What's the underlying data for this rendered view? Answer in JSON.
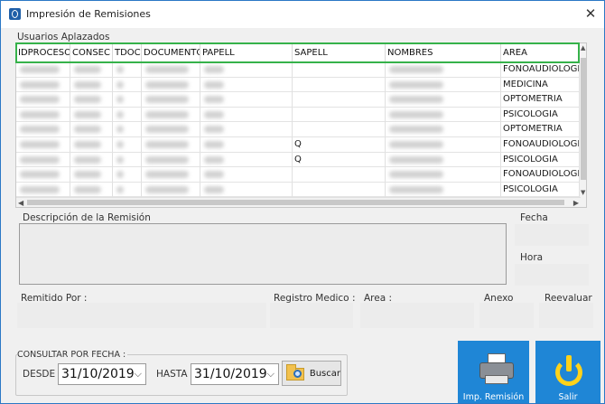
{
  "window": {
    "title": "Impresión de Remisiones",
    "close_glyph": "✕"
  },
  "grid": {
    "group_label": "Usuarios Aplazados",
    "columns": [
      "IDPROCESO",
      "CONSEC",
      "TDOC",
      "DOCUMENTO",
      "PAPELL",
      "SAPELL",
      "NOMBRES",
      "AREA"
    ],
    "rows": [
      {
        "sapell": "",
        "area": "FONOAUDIOLOGIA"
      },
      {
        "sapell": "",
        "area": "MEDICINA"
      },
      {
        "sapell": "",
        "area": "OPTOMETRIA"
      },
      {
        "sapell": "",
        "area": "PSICOLOGIA"
      },
      {
        "sapell": "",
        "area": "OPTOMETRIA"
      },
      {
        "sapell": "Q",
        "area": "FONOAUDIOLOGIA"
      },
      {
        "sapell": "Q",
        "area": "PSICOLOGIA"
      },
      {
        "sapell": "",
        "area": "FONOAUDIOLOGIA"
      },
      {
        "sapell": "",
        "area": "PSICOLOGIA"
      }
    ]
  },
  "descripcion": {
    "label": "Descripción de la Remisión"
  },
  "fecha": {
    "label": "Fecha"
  },
  "hora": {
    "label": "Hora"
  },
  "remitido": {
    "label": "Remitido Por :"
  },
  "registro": {
    "label": "Registro Medico :"
  },
  "area": {
    "label": "Area :"
  },
  "anexo": {
    "label": "Anexo"
  },
  "reevaluar": {
    "label": "Reevaluar"
  },
  "consulta": {
    "label": "CONSULTAR POR FECHA :",
    "desde_label": "DESDE :",
    "desde_value": "31/10/2019",
    "hasta_label": "HASTA :",
    "hasta_value": "31/10/2019",
    "buscar_label": "Buscar"
  },
  "actions": {
    "imprimir_label": "Imp. Remisión",
    "salir_label": "Salir"
  },
  "colors": {
    "accent": "#1f86d6",
    "highlight": "#36b24a",
    "power": "#ffd21a"
  }
}
